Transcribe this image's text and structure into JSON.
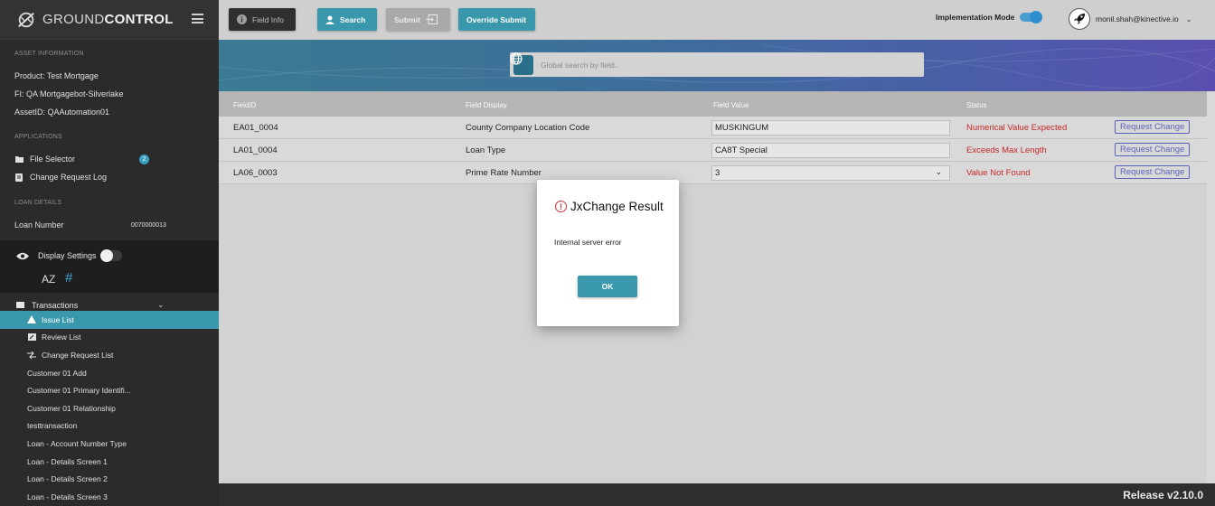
{
  "sidebar": {
    "brand": {
      "light": "GROUND",
      "bold": "CONTROL"
    },
    "asset_info": {
      "title": "ASSET INFORMATION",
      "product": "Product:  Test Mortgage",
      "fi": "FI:  QA Mortgagebot-Silverlake",
      "asset_id": "AssetID:  QAAutomation01"
    },
    "applications": {
      "title": "APPLICATIONS",
      "file_selector": "File Selector",
      "file_selector_badge": "2",
      "change_request_log": "Change Request Log"
    },
    "loan_details": {
      "title": "LOAN DETAILS",
      "loan_number_label": "Loan Number",
      "loan_number_value": "0070000013"
    },
    "display_settings": {
      "label": "Display Settings",
      "az": "AZ",
      "hash": "#"
    },
    "transactions": {
      "label": "Transactions",
      "items": [
        {
          "label": "Issue List",
          "icon": "warning-icon"
        },
        {
          "label": "Review List",
          "icon": "review-icon"
        },
        {
          "label": "Change Request List",
          "icon": "compare-icon"
        },
        {
          "label": "Customer 01 Add"
        },
        {
          "label": "Customer 01 Primary Identifi..."
        },
        {
          "label": "Customer 01 Relationship"
        },
        {
          "label": "testtransaction"
        },
        {
          "label": "Loan - Account Number Type"
        },
        {
          "label": "Loan - Details Screen 1"
        },
        {
          "label": "Loan - Details Screen 2"
        },
        {
          "label": "Loan - Details Screen 3"
        }
      ]
    }
  },
  "toolbar": {
    "field_info": "Field Info",
    "search": "Search",
    "submit": "Submit",
    "override_submit": "Override Submit",
    "implementation_mode": "Implementation Mode",
    "implementation_mode_on": true,
    "user_email": "monil.shah@kinective.io"
  },
  "search": {
    "placeholder": "Global search by field.."
  },
  "table": {
    "headers": {
      "field_id": "FieldID",
      "field_display": "Field Display",
      "field_value": "Field Value",
      "status": "Status"
    },
    "rows": [
      {
        "field_id": "EA01_0004",
        "display": "County Company Location Code",
        "value": "MUSKINGUM",
        "status": "Numerical Value Expected",
        "action": "Request Change",
        "dropdown": false
      },
      {
        "field_id": "LA01_0004",
        "display": "Loan Type",
        "value": "CA8T Special",
        "status": "Exceeds Max Length",
        "action": "Request Change",
        "dropdown": false
      },
      {
        "field_id": "LA06_0003",
        "display": "Prime Rate Number",
        "value": "3",
        "status": "Value Not Found",
        "action": "Request Change",
        "dropdown": true
      }
    ]
  },
  "modal": {
    "title": "JxChange Result",
    "message": "Internal server error",
    "ok": "OK"
  },
  "footer": {
    "release": "Release v2.10.0"
  },
  "colors": {
    "accent": "#3a98ac",
    "error": "#c62828",
    "link": "#5a63b8",
    "sidebar": "#2b2b2b"
  }
}
